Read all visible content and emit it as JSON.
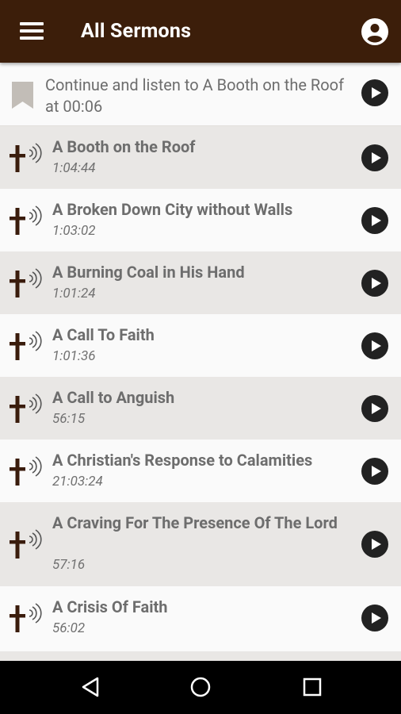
{
  "app_bar": {
    "title": "All Sermons",
    "menu_icon": "hamburger-menu-icon",
    "account_icon": "account-circle-icon",
    "background": "#3c1e0a"
  },
  "continue_banner": {
    "text": "Continue and listen to A Booth on the Roof at 00:06",
    "icon": "bookmark-icon",
    "action_icon": "play-circle-icon"
  },
  "sermons": [
    {
      "title": "A Booth on the Roof",
      "duration": "1:04:44"
    },
    {
      "title": "A Broken Down City without Walls",
      "duration": "1:03:02"
    },
    {
      "title": "A Burning Coal in His Hand",
      "duration": "1:01:24"
    },
    {
      "title": "A Call To Faith",
      "duration": "1:01:36"
    },
    {
      "title": "A Call to Anguish",
      "duration": "56:15"
    },
    {
      "title": "A Christian's Response to Calamities",
      "duration": "21:03:24"
    },
    {
      "title": "A Craving For The Presence Of The Lord",
      "duration": "57:16"
    },
    {
      "title": "A Crisis Of Faith",
      "duration": "56:02"
    }
  ],
  "system_nav": {
    "back_icon": "back-triangle-icon",
    "home_icon": "home-circle-icon",
    "recents_icon": "recents-square-icon"
  },
  "colors": {
    "accent": "#3c1e0a",
    "cross": "#3a1c0c",
    "row_shade": "#e9e7e5",
    "text_gray": "#6d6d6d",
    "play": "#222222"
  }
}
